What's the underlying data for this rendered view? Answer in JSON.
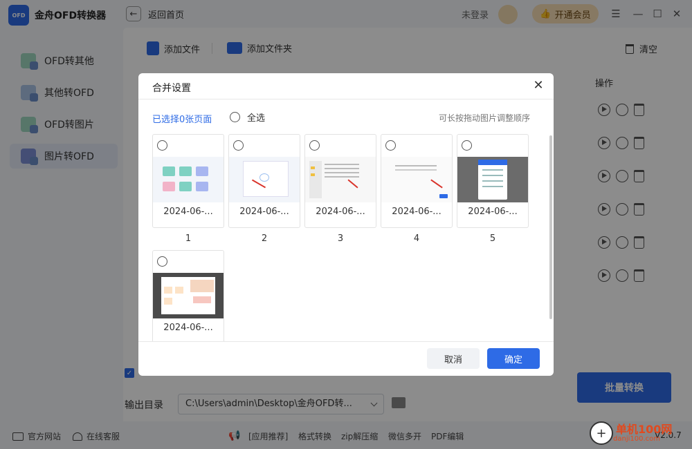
{
  "app": {
    "title": "金舟OFD转换器",
    "logo_text": "OFD"
  },
  "sidebar": {
    "items": [
      {
        "label": "OFD转其他",
        "active": false
      },
      {
        "label": "其他转OFD",
        "active": false
      },
      {
        "label": "OFD转图片",
        "active": false
      },
      {
        "label": "图片转OFD",
        "active": true
      }
    ]
  },
  "topbar": {
    "back_label": "返回首页",
    "login_text": "未登录",
    "vip_label": "开通会员"
  },
  "toolbar": {
    "add_file": "添加文件",
    "add_folder": "添加文件夹",
    "clear": "清空"
  },
  "table": {
    "op_header": "操作",
    "row_count": 6
  },
  "bottom": {
    "output_label": "输出目录",
    "output_path": "C:\\Users\\admin\\Desktop\\金舟OFD转...",
    "batch_button": "批量转换"
  },
  "footer": {
    "official_site": "官方网站",
    "online_service": "在线客服",
    "links": [
      "[应用推荐]",
      "格式转换",
      "zip解压缩",
      "微信多开",
      "PDF编辑"
    ],
    "version": "V2.0.7"
  },
  "watermark": {
    "main": "单机100网",
    "sub": "danji100.com"
  },
  "dialog": {
    "title": "合并设置",
    "selected_text": "已选择0张页面",
    "select_all": "全选",
    "hint": "可长按拖动图片调整顺序",
    "cancel": "取消",
    "confirm": "确定",
    "thumbnails": [
      {
        "date": "2024-06-...",
        "number": "1"
      },
      {
        "date": "2024-06-...",
        "number": "2"
      },
      {
        "date": "2024-06-...",
        "number": "3"
      },
      {
        "date": "2024-06-...",
        "number": "4"
      },
      {
        "date": "2024-06-...",
        "number": "5"
      },
      {
        "date": "2024-06-...",
        "number": ""
      }
    ]
  },
  "colors": {
    "accent": "#2e6be6",
    "vip": "#f6ddb4"
  }
}
